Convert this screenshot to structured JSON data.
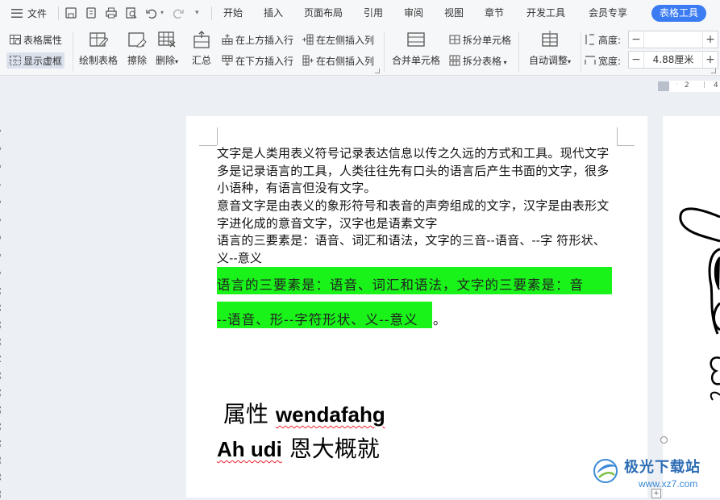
{
  "menubar": {
    "file_label": "文件",
    "tabs": [
      "开始",
      "插入",
      "页面布局",
      "引用",
      "审阅",
      "视图",
      "章节",
      "开发工具",
      "会员专享"
    ],
    "active_tab": "表格工具"
  },
  "ribbon": {
    "table_props": "表格属性",
    "show_gridlines": "显示虚框",
    "draw_table": "绘制表格",
    "erase": "擦除",
    "delete": "删除",
    "summary": "汇总",
    "insert_above": "在上方插入行",
    "insert_below": "在下方插入行",
    "insert_left": "在左侧插入列",
    "insert_right": "在右侧插入列",
    "merge_cells": "合并单元格",
    "split_cells": "拆分单元格",
    "split_table": "拆分表格",
    "auto_fit": "自动调整",
    "height_label": "高度:",
    "height_value": "",
    "width_label": "宽度:",
    "width_value": "4.88厘米"
  },
  "ruler": {
    "h_marks": [
      "2",
      "4"
    ],
    "v_marks": [
      "1",
      "2",
      "3",
      "4",
      "5",
      "6",
      "7",
      "8",
      "9",
      "10",
      "11",
      "12",
      "13",
      "14",
      "15",
      "16",
      "17",
      "18",
      "19",
      "20",
      "21",
      "22"
    ]
  },
  "document": {
    "para1": "文字是人类用表义符号记录表达信息以传之久远的方式和工具。现代文字多是记录语言的工具，人类往往先有口头的语言后产生书面的文字，很多小语种，有语言但没有文字。",
    "para2": "意音文字是由表义的象形符号和表音的声旁组成的文字，汉字是由表形文字进化成的意音文字，汉字也是语素文字",
    "para3": "语言的三要素是：语音、词汇和语法，文字的三音--语音、--字  符形状、义--意义",
    "highlight_line1": "语言的三要素是：语音、词汇和语法，文字的三要素是：音",
    "highlight_line2": "--语音、形--字符形状、义--意义",
    "highlight_period": "。",
    "big_line1_cn": "属性",
    "big_line1_en": "wendafahg",
    "big_line2_en": "Ah udi",
    "big_line2_cn": "恩大概就"
  },
  "watermark": {
    "title": "极光下载站",
    "url": "www.xz7.com"
  }
}
